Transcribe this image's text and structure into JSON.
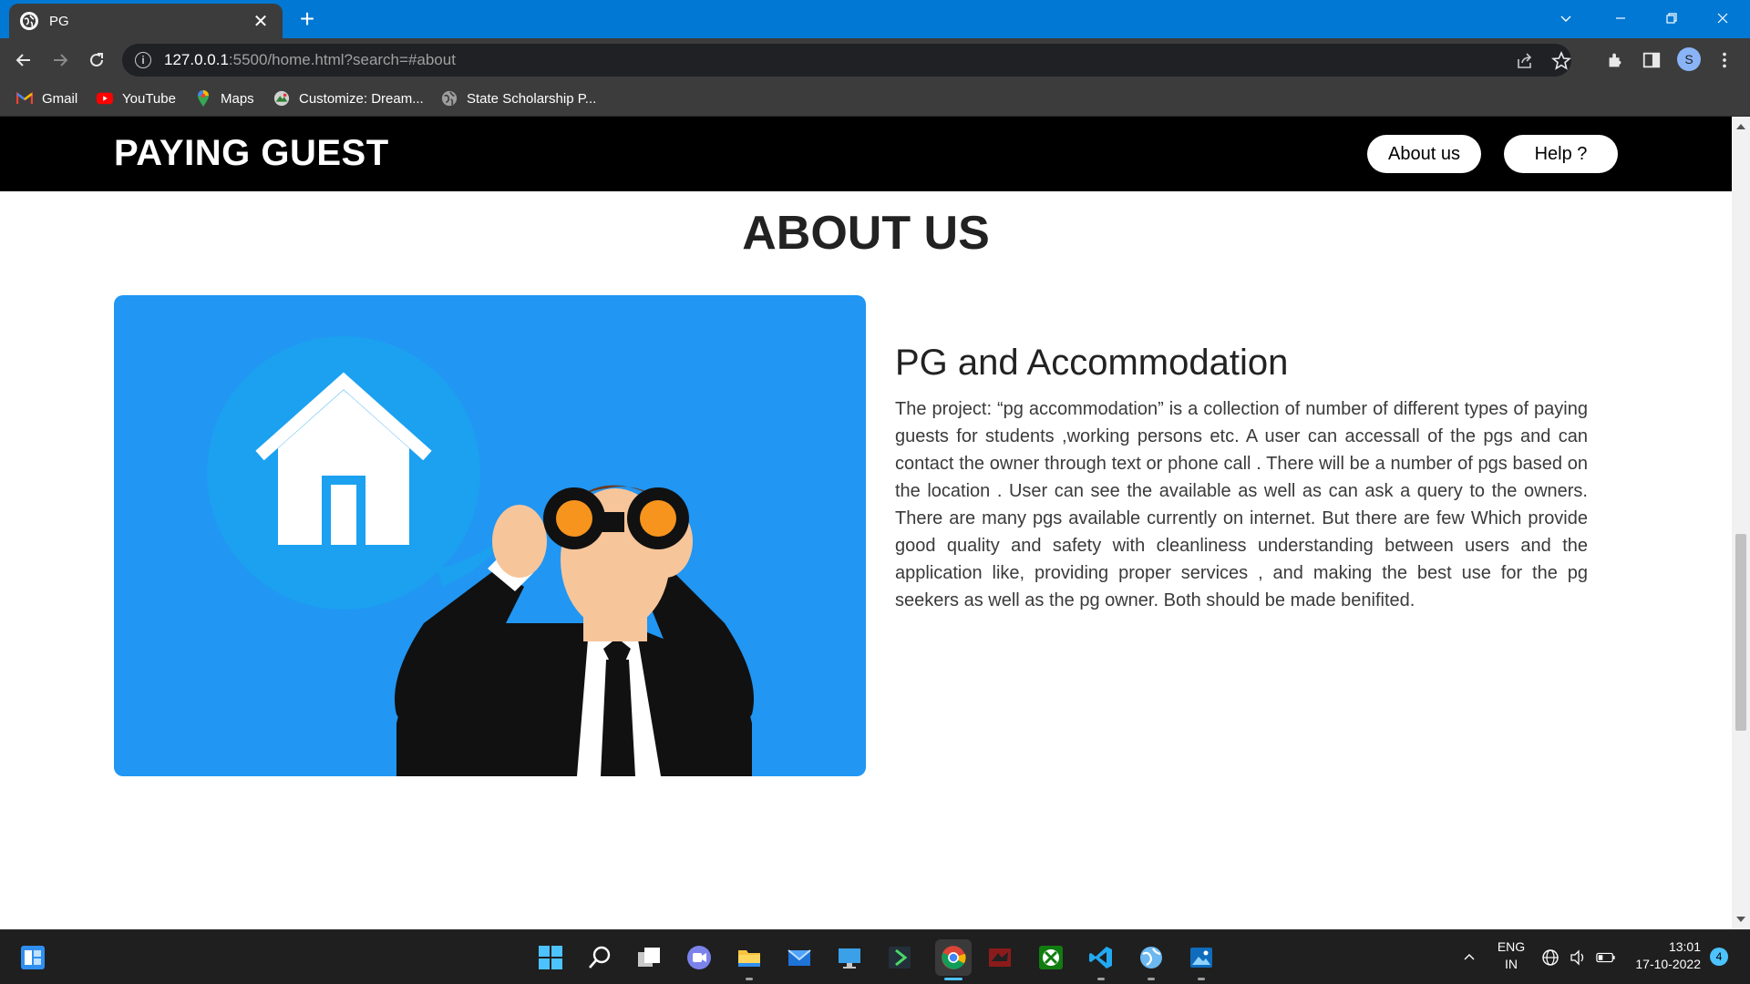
{
  "browser": {
    "tab_title": "PG",
    "url_host": "127.0.0.1",
    "url_rest": ":5500/home.html?search=#about",
    "new_tab_label": "+",
    "close_tab_label": "✕",
    "profile_initial": "S",
    "bookmarks": [
      {
        "label": "Gmail",
        "icon": "gmail-icon"
      },
      {
        "label": "YouTube",
        "icon": "youtube-icon"
      },
      {
        "label": "Maps",
        "icon": "maps-icon"
      },
      {
        "label": "Customize: Dream...",
        "icon": "customize-icon"
      },
      {
        "label": "State Scholarship P...",
        "icon": "globe-icon"
      }
    ]
  },
  "site": {
    "brand": "PAYING GUEST",
    "nav": {
      "about": "About us",
      "help": "Help ?"
    },
    "section_title": "ABOUT US",
    "heading": "PG and Accommodation",
    "paragraph": "The project: “pg accommodation” is a collection of number of different types of paying guests for students ,working persons etc. A user can accessall of the pgs and can contact the owner through text or phone call . There will be a number of pgs based on the location . User can see the available as well as can ask a query to the owners. There are many pgs available currently on internet. But there are few Which provide good quality and safety with cleanliness understanding between users and the application like, providing proper services , and making the best use for the pg seekers as well as the pg owner. Both should be made benifited.",
    "hero_bg_color": "#2196f3"
  },
  "taskbar": {
    "lang_top": "ENG",
    "lang_bottom": "IN",
    "time": "13:01",
    "date": "17-10-2022",
    "notification_count": "4"
  }
}
